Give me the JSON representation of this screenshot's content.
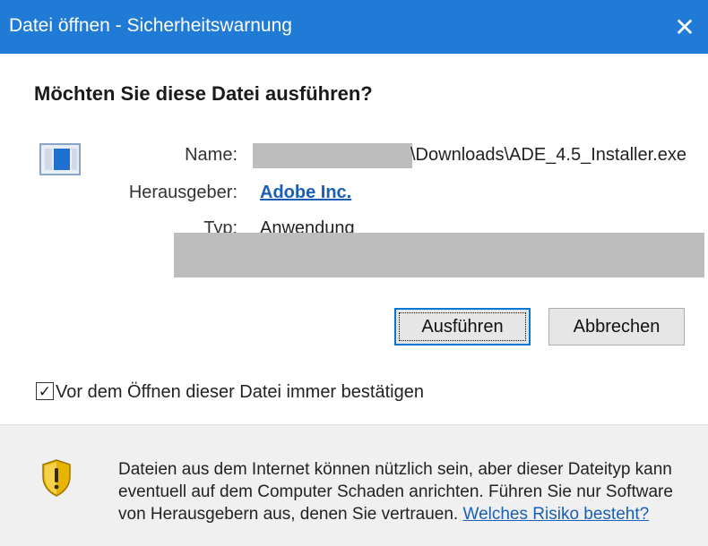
{
  "window": {
    "title": "Datei öffnen - Sicherheitswarnung",
    "close_glyph": "✕"
  },
  "question": "Möchten Sie diese Datei ausführen?",
  "icon": "application-icon",
  "fields": {
    "name_label": "Name:",
    "name_value": "\\Downloads\\ADE_4.5_Installer.exe",
    "publisher_label": "Herausgeber:",
    "publisher_value": "Adobe Inc.",
    "type_label": "Typ:",
    "type_value": "Anwendung"
  },
  "buttons": {
    "run": "Ausführen",
    "cancel": "Abbrechen"
  },
  "checkbox": {
    "checked": true,
    "glyph": "✓",
    "label": "Vor dem Öffnen dieser Datei immer bestätigen"
  },
  "warning": {
    "icon": "shield-warning-icon",
    "line1": "Dateien aus dem Internet können nützlich sein, aber dieser Dateityp kann",
    "line2": "eventuell auf dem Computer Schaden anrichten. Führen Sie nur Software",
    "line3": "von Herausgebern aus, denen Sie vertrauen.",
    "link": "Welches Risiko besteht?"
  },
  "colors": {
    "titlebar": "#1f7bd6",
    "link": "#1a5fb4",
    "redaction": "#bdbdbd",
    "shield_gold": "#e8b400"
  }
}
